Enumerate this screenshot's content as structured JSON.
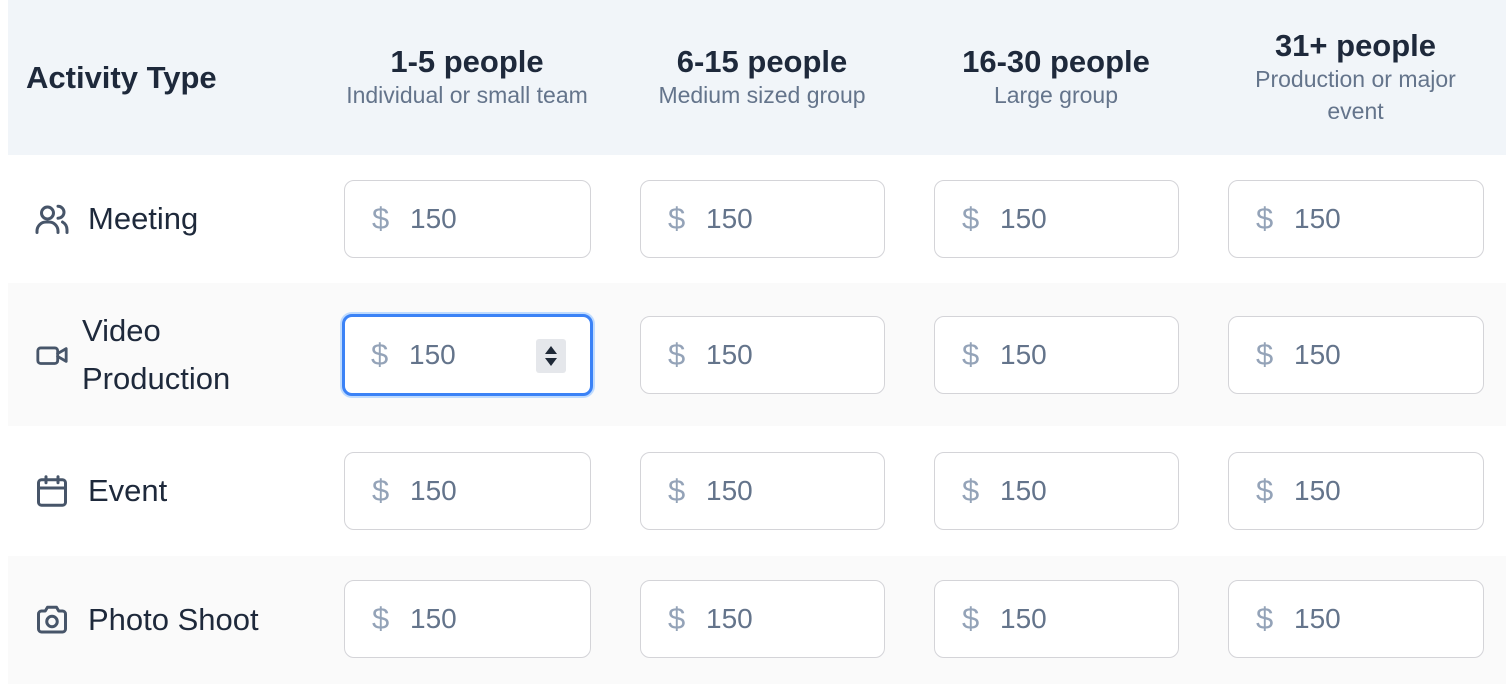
{
  "header": {
    "activity_type": "Activity Type",
    "columns": [
      {
        "title": "1-5 people",
        "subtitle": "Individual or small team"
      },
      {
        "title": "6-15 people",
        "subtitle": "Medium sized group"
      },
      {
        "title": "16-30 people",
        "subtitle": "Large group"
      },
      {
        "title": "31+ people",
        "subtitle": "Production or major event"
      }
    ]
  },
  "currency_symbol": "$",
  "rows": [
    {
      "label": "Meeting",
      "icon": "users-icon",
      "values": [
        "150",
        "150",
        "150",
        "150"
      ]
    },
    {
      "label": "Video Production",
      "icon": "video-icon",
      "values": [
        "150",
        "150",
        "150",
        "150"
      ]
    },
    {
      "label": "Event",
      "icon": "calendar-icon",
      "values": [
        "150",
        "150",
        "150",
        "150"
      ]
    },
    {
      "label": "Photo Shoot",
      "icon": "camera-icon",
      "values": [
        "150",
        "150",
        "150",
        "150"
      ]
    }
  ],
  "colors": {
    "header_bg": "#f1f5f9",
    "focus": "#3b82f6",
    "alt_row": "#fafafa"
  }
}
